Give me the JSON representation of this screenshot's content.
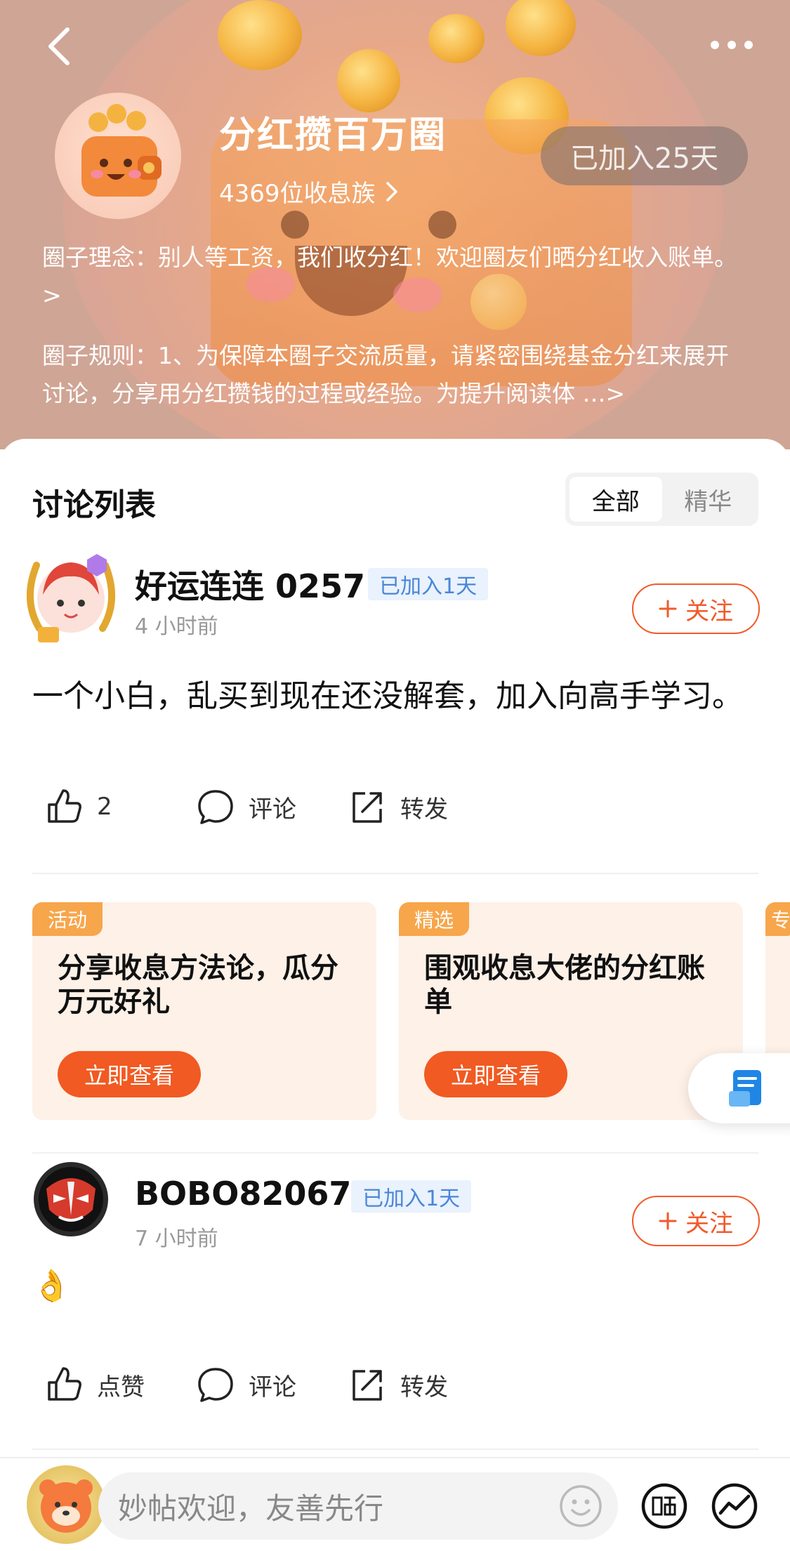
{
  "circle": {
    "title": "分红攒百万圈",
    "members": "4369位收息族",
    "joined": "已加入25天",
    "concept": "圈子理念：别人等工资，我们收分红！欢迎圈友们晒分红收入账单。>",
    "rules": "圈子规则：1、为保障本圈子交流质量，请紧密围绕基金分红来展开讨论，分享用分红攒钱的过程或经验。为提升阅读体 …>"
  },
  "list": {
    "title": "讨论列表",
    "tabs": [
      "全部",
      "精华"
    ]
  },
  "posts": [
    {
      "username": "好运连连 0257",
      "joined": "已加入1天",
      "time": "4 小时前",
      "follow": "关注",
      "body": "一个小白，乱买到现在还没解套，加入向高手学习。",
      "like": "2",
      "comment": "评论",
      "share": "转发"
    },
    {
      "username": "BOBO82067",
      "joined": "已加入1天",
      "time": "7 小时前",
      "follow": "关注",
      "body": "👌",
      "like": "点赞",
      "comment": "评论",
      "share": "转发"
    }
  ],
  "cards": [
    {
      "tag": "活动",
      "title": "分享收息方法论，瓜分万元好礼",
      "button": "立即查看"
    },
    {
      "tag": "精选",
      "title": "围观收息大佬的分红账单",
      "button": "立即查看"
    },
    {
      "tag": "专",
      "title": "",
      "button": ""
    }
  ],
  "bottom": {
    "placeholder": "妙帖欢迎，友善先行"
  },
  "colors": {
    "accent": "#f15a22",
    "tag_blue": "#4a86d8",
    "card_tag": "#f7a64b"
  }
}
